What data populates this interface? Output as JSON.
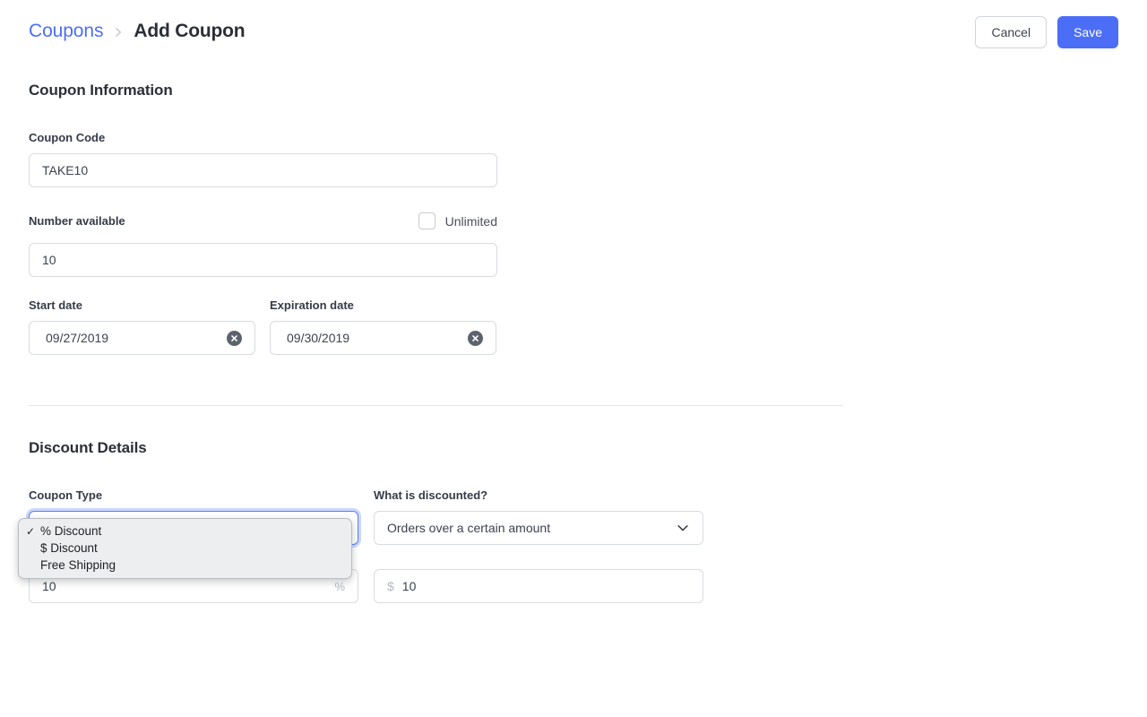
{
  "breadcrumb": {
    "parent": "Coupons",
    "separator_icon": "chevron-right-icon",
    "current": "Add Coupon"
  },
  "toolbar": {
    "cancel_label": "Cancel",
    "save_label": "Save",
    "accent_color": "#4c6ef7"
  },
  "sections": {
    "coupon_information": {
      "title": "Coupon Information",
      "coupon_code": {
        "label": "Coupon Code",
        "value": "TAKE10"
      },
      "number_available": {
        "label": "Number available",
        "value": "10",
        "unlimited_label": "Unlimited",
        "unlimited_checked": false
      },
      "start_date": {
        "label": "Start date",
        "value": "09/27/2019",
        "clear_icon": "clear-circle-icon"
      },
      "expiration_date": {
        "label": "Expiration date",
        "value": "09/30/2019",
        "clear_icon": "clear-circle-icon"
      }
    },
    "discount_details": {
      "title": "Discount Details",
      "coupon_type": {
        "label": "Coupon Type",
        "selected": "% Discount",
        "open": true,
        "options": [
          {
            "label": "% Discount",
            "checked": true
          },
          {
            "label": "$ Discount",
            "checked": false
          },
          {
            "label": "Free Shipping",
            "checked": false
          }
        ],
        "check_glyph": "✓"
      },
      "discount_amount": {
        "value": "10",
        "suffix": "%"
      },
      "what_is_discounted": {
        "label": "What is discounted?",
        "selected": "Orders over a certain amount",
        "chevron_icon": "chevron-down-icon"
      },
      "threshold_amount": {
        "prefix": "$",
        "value": "10"
      }
    }
  }
}
